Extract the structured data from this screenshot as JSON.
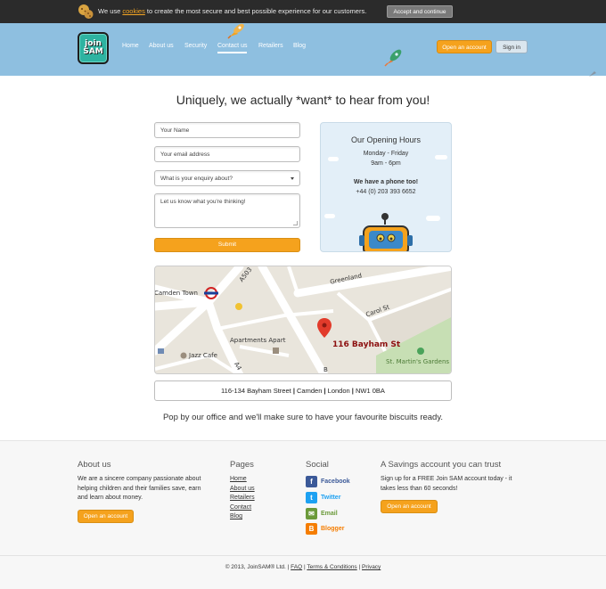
{
  "cookie_bar": {
    "text_before": "We use",
    "link": "cookies",
    "text_after": "to create the most secure and best possible experience for our customers.",
    "accept_button": "Accept and continue"
  },
  "header": {
    "logo_line1": "join",
    "logo_line2": "SAM",
    "nav": [
      "Home",
      "About us",
      "Security",
      "Contact us",
      "Retailers",
      "Blog"
    ],
    "active_nav": "Contact us",
    "open_account": "Open an account",
    "sign_in": "Sign in"
  },
  "main": {
    "headline": "Uniquely, we actually *want* to hear from you!",
    "form": {
      "name_placeholder": "Your Name",
      "email_placeholder": "Your email address",
      "enquiry_select": "What is your enquiry about?",
      "message_placeholder": "Let us know what you're thinking!",
      "submit": "Submit"
    },
    "hours": {
      "title": "Our Opening Hours",
      "days": "Monday - Friday",
      "time": "9am - 6pm",
      "phone_heading": "We have a phone too!",
      "phone": "+44 (0) 203 393 6652"
    },
    "map": {
      "labels": {
        "camden_town": "Camden Town",
        "a503": "A503",
        "greenland": "Greenland",
        "carol_st": "Carol St",
        "apartments": "Apartments Apart",
        "jazz_cafe": "Jazz Cafe",
        "marker": "116 Bayham St",
        "st_martins": "St. Martin's Gardens",
        "a4": "A4",
        "b": "B"
      }
    },
    "address_parts": [
      "116-134 Bayham Street",
      "Camden",
      "London",
      "NW1 0BA"
    ],
    "tagline": "Pop by our office and we'll make sure to have your favourite biscuits ready."
  },
  "footer": {
    "about": {
      "heading": "About us",
      "text": "We are a sincere company passionate about helping children and their families save, earn and learn about money.",
      "button": "Open an account"
    },
    "pages": {
      "heading": "Pages",
      "links": [
        "Home",
        "About us",
        "Retailers",
        "Contact",
        "Blog"
      ]
    },
    "social": {
      "heading": "Social",
      "items": [
        {
          "label": "Facebook",
          "icon": "facebook-icon",
          "color": "#3b5998"
        },
        {
          "label": "Twitter",
          "icon": "twitter-icon",
          "color": "#1da1f2"
        },
        {
          "label": "Email",
          "icon": "email-icon",
          "color": "#6b9a3a"
        },
        {
          "label": "Blogger",
          "icon": "blogger-icon",
          "color": "#f57d00"
        }
      ]
    },
    "savings": {
      "heading": "A Savings account you can trust",
      "text": "Sign up for a FREE Join SAM account today - it takes less than 60 seconds!",
      "button": "Open an account"
    },
    "copyright": {
      "text": "© 2013, JoinSAM® Ltd.",
      "faq": "FAQ",
      "terms": "Terms & Conditions",
      "privacy": "Privacy"
    }
  },
  "colors": {
    "accent_orange": "#f5a21d",
    "header_blue": "#8ebfe0",
    "cookie_bar": "#2b2b2b",
    "logo_teal": "#2eb3a1"
  }
}
